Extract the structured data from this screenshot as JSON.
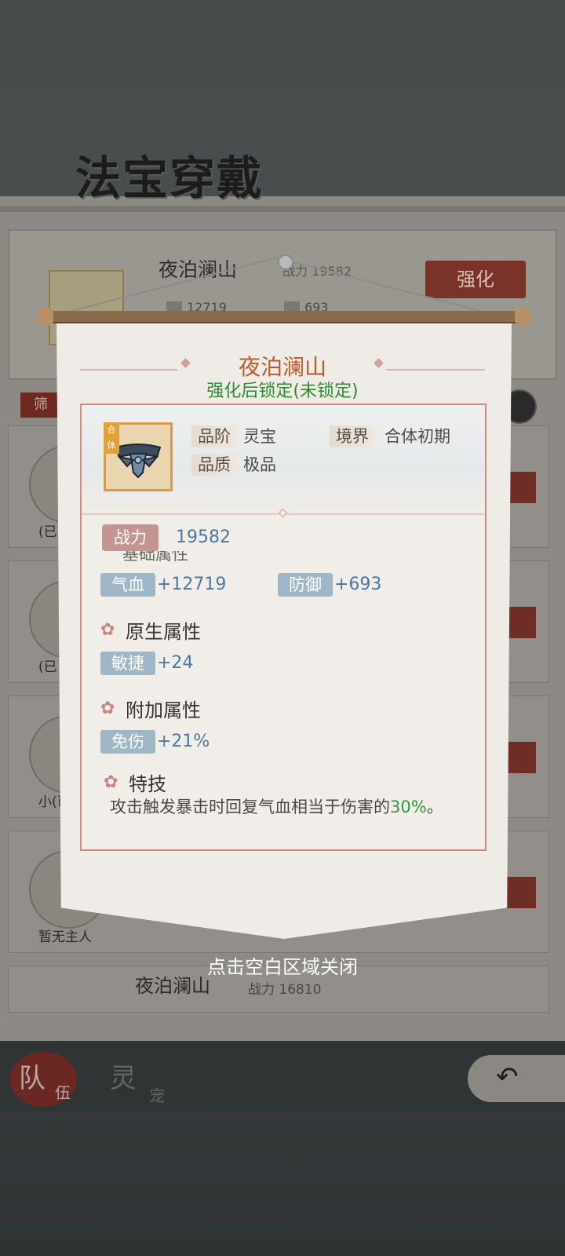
{
  "page": {
    "title": "法宝穿戴"
  },
  "equipped": {
    "name": "夜泊澜山",
    "power_label": "战力",
    "power": "19582",
    "hp": "12719",
    "def": "693",
    "enhance_label": "强化"
  },
  "filter": {
    "label": "筛"
  },
  "list": [
    {
      "owner": "(已"
    },
    {
      "owner": "(已"
    },
    {
      "owner": "小(已"
    },
    {
      "owner": "暂无主人"
    }
  ],
  "list_bottom": {
    "name": "夜泊澜山",
    "power": "战力 16810"
  },
  "nav": {
    "team_main": "队",
    "team_sub": "伍",
    "pet_main": "灵",
    "pet_sub": "宠",
    "back_arrow": "↶"
  },
  "dialog": {
    "title": "夜泊澜山",
    "subtitle": "强化后锁定(未锁定)",
    "icon_tag": "合体",
    "grade_label": "品阶",
    "grade_value": "灵宝",
    "realm_label": "境界",
    "realm_value": "合体初期",
    "quality_label": "品质",
    "quality_value": "极品",
    "power_label": "战力",
    "power_value": "19582",
    "base_attr_title": "基础属性",
    "hp_label": "气血",
    "hp_value": "+12719",
    "def_label": "防御",
    "def_value": "+693",
    "native_title": "原生属性",
    "agility_label": "敏捷",
    "agility_value": "+24",
    "extra_title": "附加属性",
    "dmgreduce_label": "免伤",
    "dmgreduce_value": "+21%",
    "skill_title": "特技",
    "skill_desc_prefix": "攻击触发暴击时回复气血相当于伤害的",
    "skill_desc_highlight": "30%",
    "skill_desc_suffix": "。",
    "close_hint": "点击空白区域关闭"
  },
  "colors": {
    "title": "#b85c2c",
    "locked_status": "#2e8b2e",
    "stat_value": "#4b78a2",
    "highlight": "#2e9b3a"
  }
}
